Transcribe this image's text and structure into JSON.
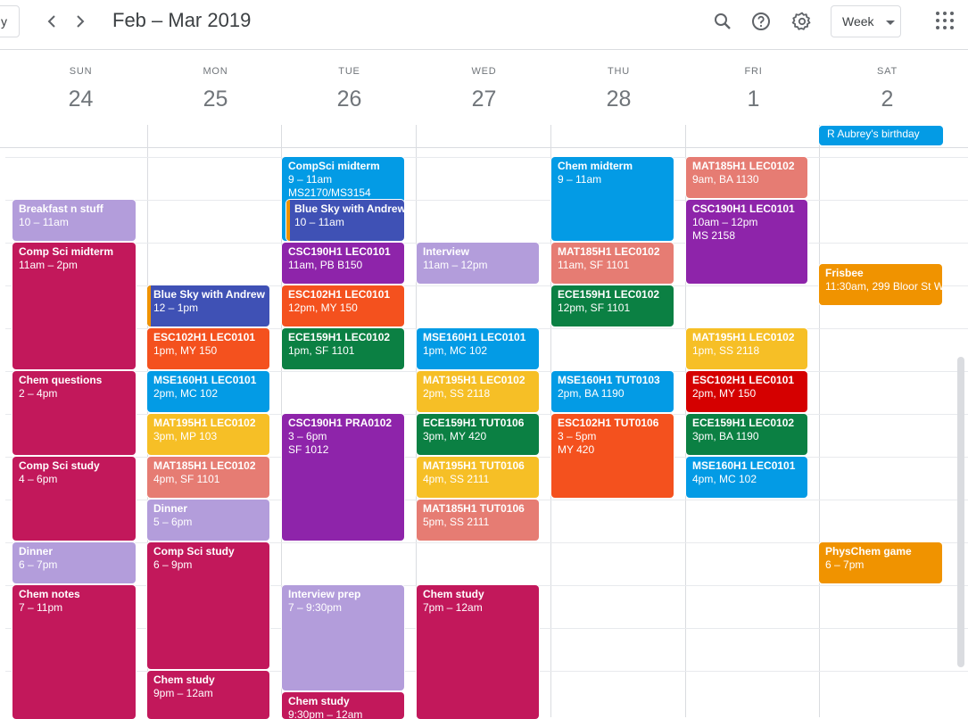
{
  "header": {
    "today_label": "y",
    "prev_icon": "chevron-left-icon",
    "next_icon": "chevron-right-icon",
    "title": "Feb – Mar 2019",
    "search_icon": "search-icon",
    "help_icon": "help-icon",
    "settings_icon": "gear-icon",
    "view_label": "Week",
    "apps_icon": "apps-grid-icon"
  },
  "days": [
    {
      "dow": "SUN",
      "num": "24"
    },
    {
      "dow": "MON",
      "num": "25"
    },
    {
      "dow": "TUE",
      "num": "26"
    },
    {
      "dow": "WED",
      "num": "27"
    },
    {
      "dow": "THU",
      "num": "28"
    },
    {
      "dow": "FRI",
      "num": "1"
    },
    {
      "dow": "SAT",
      "num": "2"
    }
  ],
  "colors": {
    "blue": "#039be5",
    "lavender": "#b39ddb",
    "crimson": "#c2185b",
    "indigo": "#3f51b5",
    "purple": "#8e24aa",
    "red": "#f4511e",
    "green": "#0b8043",
    "yellow": "#f6bf26",
    "coral": "#e67c73",
    "orange": "#f09300",
    "tomato": "#d50000"
  },
  "allday": {
    "title": "R Aubrey's birthday"
  },
  "events": {
    "sun": [
      {
        "title": "Breakfast n stuff",
        "time": "10 – 11am"
      },
      {
        "title": "Comp Sci midterm",
        "time": "11am – 2pm"
      },
      {
        "title": "Chem questions",
        "time": "2 – 4pm"
      },
      {
        "title": "Comp Sci study",
        "time": "4 – 6pm"
      },
      {
        "title": "Dinner",
        "time": "6 – 7pm"
      },
      {
        "title": "Chem notes",
        "time": "7 – 11pm"
      }
    ],
    "mon": [
      {
        "title": "Blue Sky with Andrew",
        "time": "12 – 1pm"
      },
      {
        "title": "ESC102H1 LEC0101",
        "time": "1pm, MY 150"
      },
      {
        "title": "MSE160H1 LEC0101",
        "time": "2pm, MC 102"
      },
      {
        "title": "MAT195H1 LEC0102",
        "time": "3pm, MP 103"
      },
      {
        "title": "MAT185H1 LEC0102",
        "time": "4pm, SF 1101"
      },
      {
        "title": "Dinner",
        "time": "5 – 6pm"
      },
      {
        "title": "Comp Sci study",
        "time": "6 – 9pm"
      },
      {
        "title": "Chem study",
        "time": "9pm – 12am"
      }
    ],
    "tue": [
      {
        "title": "CompSci midterm",
        "time": "9 – 11am",
        "loc": "MS2170/MS3154"
      },
      {
        "title": "Blue Sky with Andrew",
        "time": "10 – 11am"
      },
      {
        "title": "CSC190H1 LEC0101",
        "time": "11am, PB B150"
      },
      {
        "title": "ESC102H1 LEC0101",
        "time": "12pm, MY 150"
      },
      {
        "title": "ECE159H1 LEC0102",
        "time": "1pm, SF 1101"
      },
      {
        "title": "CSC190H1 PRA0102",
        "time": "3 – 6pm",
        "loc": "SF 1012"
      },
      {
        "title": "Interview prep",
        "time": "7 – 9:30pm"
      },
      {
        "title": "Chem study",
        "time": "9:30pm – 12am"
      }
    ],
    "wed": [
      {
        "title": "Interview",
        "time": "11am – 12pm"
      },
      {
        "title": "MSE160H1 LEC0101",
        "time": "1pm, MC 102"
      },
      {
        "title": "MAT195H1 LEC0102",
        "time": "2pm, SS 2118"
      },
      {
        "title": "ECE159H1 TUT0106",
        "time": "3pm, MY 420"
      },
      {
        "title": "MAT195H1 TUT0106",
        "time": "4pm, SS 2111"
      },
      {
        "title": "MAT185H1 TUT0106",
        "time": "5pm, SS 2111"
      },
      {
        "title": "Chem study",
        "time": "7pm – 12am"
      }
    ],
    "thu": [
      {
        "title": "Chem midterm",
        "time": "9 – 11am"
      },
      {
        "title": "MAT185H1 LEC0102",
        "time": "11am, SF 1101"
      },
      {
        "title": "ECE159H1 LEC0102",
        "time": "12pm, SF 1101"
      },
      {
        "title": "MSE160H1 TUT0103",
        "time": "2pm, BA 1190"
      },
      {
        "title": "ESC102H1 TUT0106",
        "time": "3 – 5pm",
        "loc": "MY 420"
      }
    ],
    "fri": [
      {
        "title": "MAT185H1 LEC0102",
        "time": "9am, BA 1130"
      },
      {
        "title": "CSC190H1 LEC0101",
        "time": "10am – 12pm",
        "loc": "MS 2158"
      },
      {
        "title": "MAT195H1 LEC0102",
        "time": "1pm, SS 2118"
      },
      {
        "title": "ESC102H1 LEC0101",
        "time": "2pm, MY 150"
      },
      {
        "title": "ECE159H1 LEC0102",
        "time": "3pm, BA 1190"
      },
      {
        "title": "MSE160H1 LEC0101",
        "time": "4pm, MC 102"
      }
    ],
    "sat": [
      {
        "title": "Frisbee",
        "time": "11:30am, 299 Bloor St W"
      },
      {
        "title": "PhysChem game",
        "time": "6 – 7pm"
      }
    ]
  }
}
